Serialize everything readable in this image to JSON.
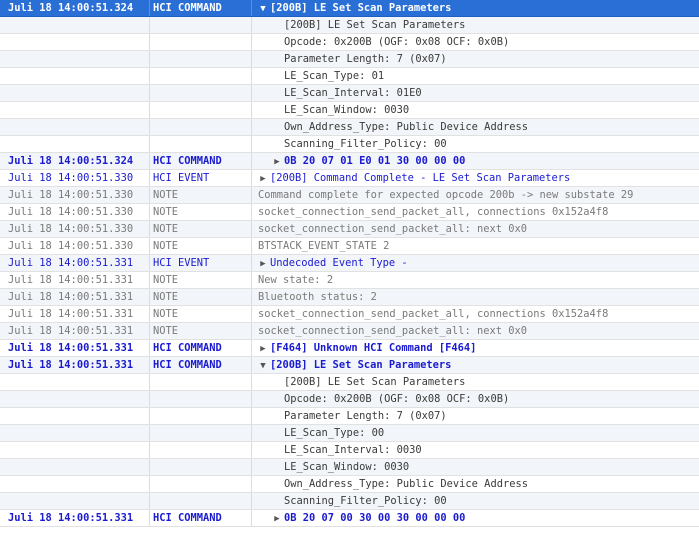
{
  "log": {
    "rows": [
      {
        "time": "Juli 18 14:00:51.324",
        "type": "HCI COMMAND",
        "message": "[200B] LE Set Scan Parameters",
        "kind": "cmd",
        "indent": 0,
        "expander": "expanded",
        "selected": true
      },
      {
        "time": "",
        "type": "",
        "message": "[200B] LE Set Scan Parameters",
        "kind": "detail",
        "indent": 2
      },
      {
        "time": "",
        "type": "",
        "message": "Opcode: 0x200B (OGF: 0x08    OCF: 0x0B)",
        "kind": "detail",
        "indent": 2
      },
      {
        "time": "",
        "type": "",
        "message": "Parameter Length: 7 (0x07)",
        "kind": "detail",
        "indent": 2
      },
      {
        "time": "",
        "type": "",
        "message": "LE_Scan_Type: 01",
        "kind": "detail",
        "indent": 2
      },
      {
        "time": "",
        "type": "",
        "message": "LE_Scan_Interval: 01E0",
        "kind": "detail",
        "indent": 2
      },
      {
        "time": "",
        "type": "",
        "message": "LE_Scan_Window: 0030",
        "kind": "detail",
        "indent": 2
      },
      {
        "time": "",
        "type": "",
        "message": "Own_Address_Type: Public Device Address",
        "kind": "detail",
        "indent": 2
      },
      {
        "time": "",
        "type": "",
        "message": "Scanning_Filter_Policy: 00",
        "kind": "detail",
        "indent": 2
      },
      {
        "time": "Juli 18 14:00:51.324",
        "type": "HCI COMMAND",
        "message": "0B 20 07 01 E0 01 30 00 00 00",
        "kind": "cmd",
        "indent": 1,
        "expander": "collapsed"
      },
      {
        "time": "Juli 18 14:00:51.330",
        "type": "HCI EVENT",
        "message": "[200B] Command Complete - LE Set Scan Parameters",
        "kind": "evt",
        "indent": 0,
        "expander": "collapsed"
      },
      {
        "time": "Juli 18 14:00:51.330",
        "type": "NOTE",
        "message": "Command complete for expected opcode 200b -> new substate 29",
        "kind": "note",
        "indent": 0
      },
      {
        "time": "Juli 18 14:00:51.330",
        "type": "NOTE",
        "message": "socket_connection_send_packet_all, connections 0x152a4f8",
        "kind": "note",
        "indent": 0
      },
      {
        "time": "Juli 18 14:00:51.330",
        "type": "NOTE",
        "message": "socket_connection_send_packet_all: next 0x0",
        "kind": "note",
        "indent": 0
      },
      {
        "time": "Juli 18 14:00:51.330",
        "type": "NOTE",
        "message": "BTSTACK_EVENT_STATE 2",
        "kind": "note",
        "indent": 0
      },
      {
        "time": "Juli 18 14:00:51.331",
        "type": "HCI EVENT",
        "message": "Undecoded Event Type -",
        "kind": "evt",
        "indent": 0,
        "expander": "collapsed"
      },
      {
        "time": "Juli 18 14:00:51.331",
        "type": "NOTE",
        "message": "New state: 2",
        "kind": "note",
        "indent": 0
      },
      {
        "time": "Juli 18 14:00:51.331",
        "type": "NOTE",
        "message": "Bluetooth status: 2",
        "kind": "note",
        "indent": 0
      },
      {
        "time": "Juli 18 14:00:51.331",
        "type": "NOTE",
        "message": "socket_connection_send_packet_all, connections 0x152a4f8",
        "kind": "note",
        "indent": 0
      },
      {
        "time": "Juli 18 14:00:51.331",
        "type": "NOTE",
        "message": "socket_connection_send_packet_all: next 0x0",
        "kind": "note",
        "indent": 0
      },
      {
        "time": "Juli 18 14:00:51.331",
        "type": "HCI COMMAND",
        "message": "[F464] Unknown HCI Command [F464]",
        "kind": "cmd",
        "indent": 0,
        "expander": "collapsed"
      },
      {
        "time": "Juli 18 14:00:51.331",
        "type": "HCI COMMAND",
        "message": "[200B] LE Set Scan Parameters",
        "kind": "cmd",
        "indent": 0,
        "expander": "expanded"
      },
      {
        "time": "",
        "type": "",
        "message": "[200B] LE Set Scan Parameters",
        "kind": "detail",
        "indent": 2
      },
      {
        "time": "",
        "type": "",
        "message": "Opcode: 0x200B (OGF: 0x08    OCF: 0x0B)",
        "kind": "detail",
        "indent": 2
      },
      {
        "time": "",
        "type": "",
        "message": "Parameter Length: 7 (0x07)",
        "kind": "detail",
        "indent": 2
      },
      {
        "time": "",
        "type": "",
        "message": "LE_Scan_Type: 00",
        "kind": "detail",
        "indent": 2
      },
      {
        "time": "",
        "type": "",
        "message": "LE_Scan_Interval: 0030",
        "kind": "detail",
        "indent": 2
      },
      {
        "time": "",
        "type": "",
        "message": "LE_Scan_Window: 0030",
        "kind": "detail",
        "indent": 2
      },
      {
        "time": "",
        "type": "",
        "message": "Own_Address_Type: Public Device Address",
        "kind": "detail",
        "indent": 2
      },
      {
        "time": "",
        "type": "",
        "message": "Scanning_Filter_Policy: 00",
        "kind": "detail",
        "indent": 2
      },
      {
        "time": "Juli 18 14:00:51.331",
        "type": "HCI COMMAND",
        "message": "0B 20 07 00 30 00 30 00 00 00",
        "kind": "cmd",
        "indent": 1,
        "expander": "collapsed"
      }
    ]
  },
  "icons": {
    "expanded": "▼",
    "collapsed": "▶"
  },
  "colors": {
    "selection": "#2a6fd6",
    "command_text": "#1a1ad0",
    "note_text": "#7a7a7a",
    "row_alt": "#f2f5f9"
  }
}
